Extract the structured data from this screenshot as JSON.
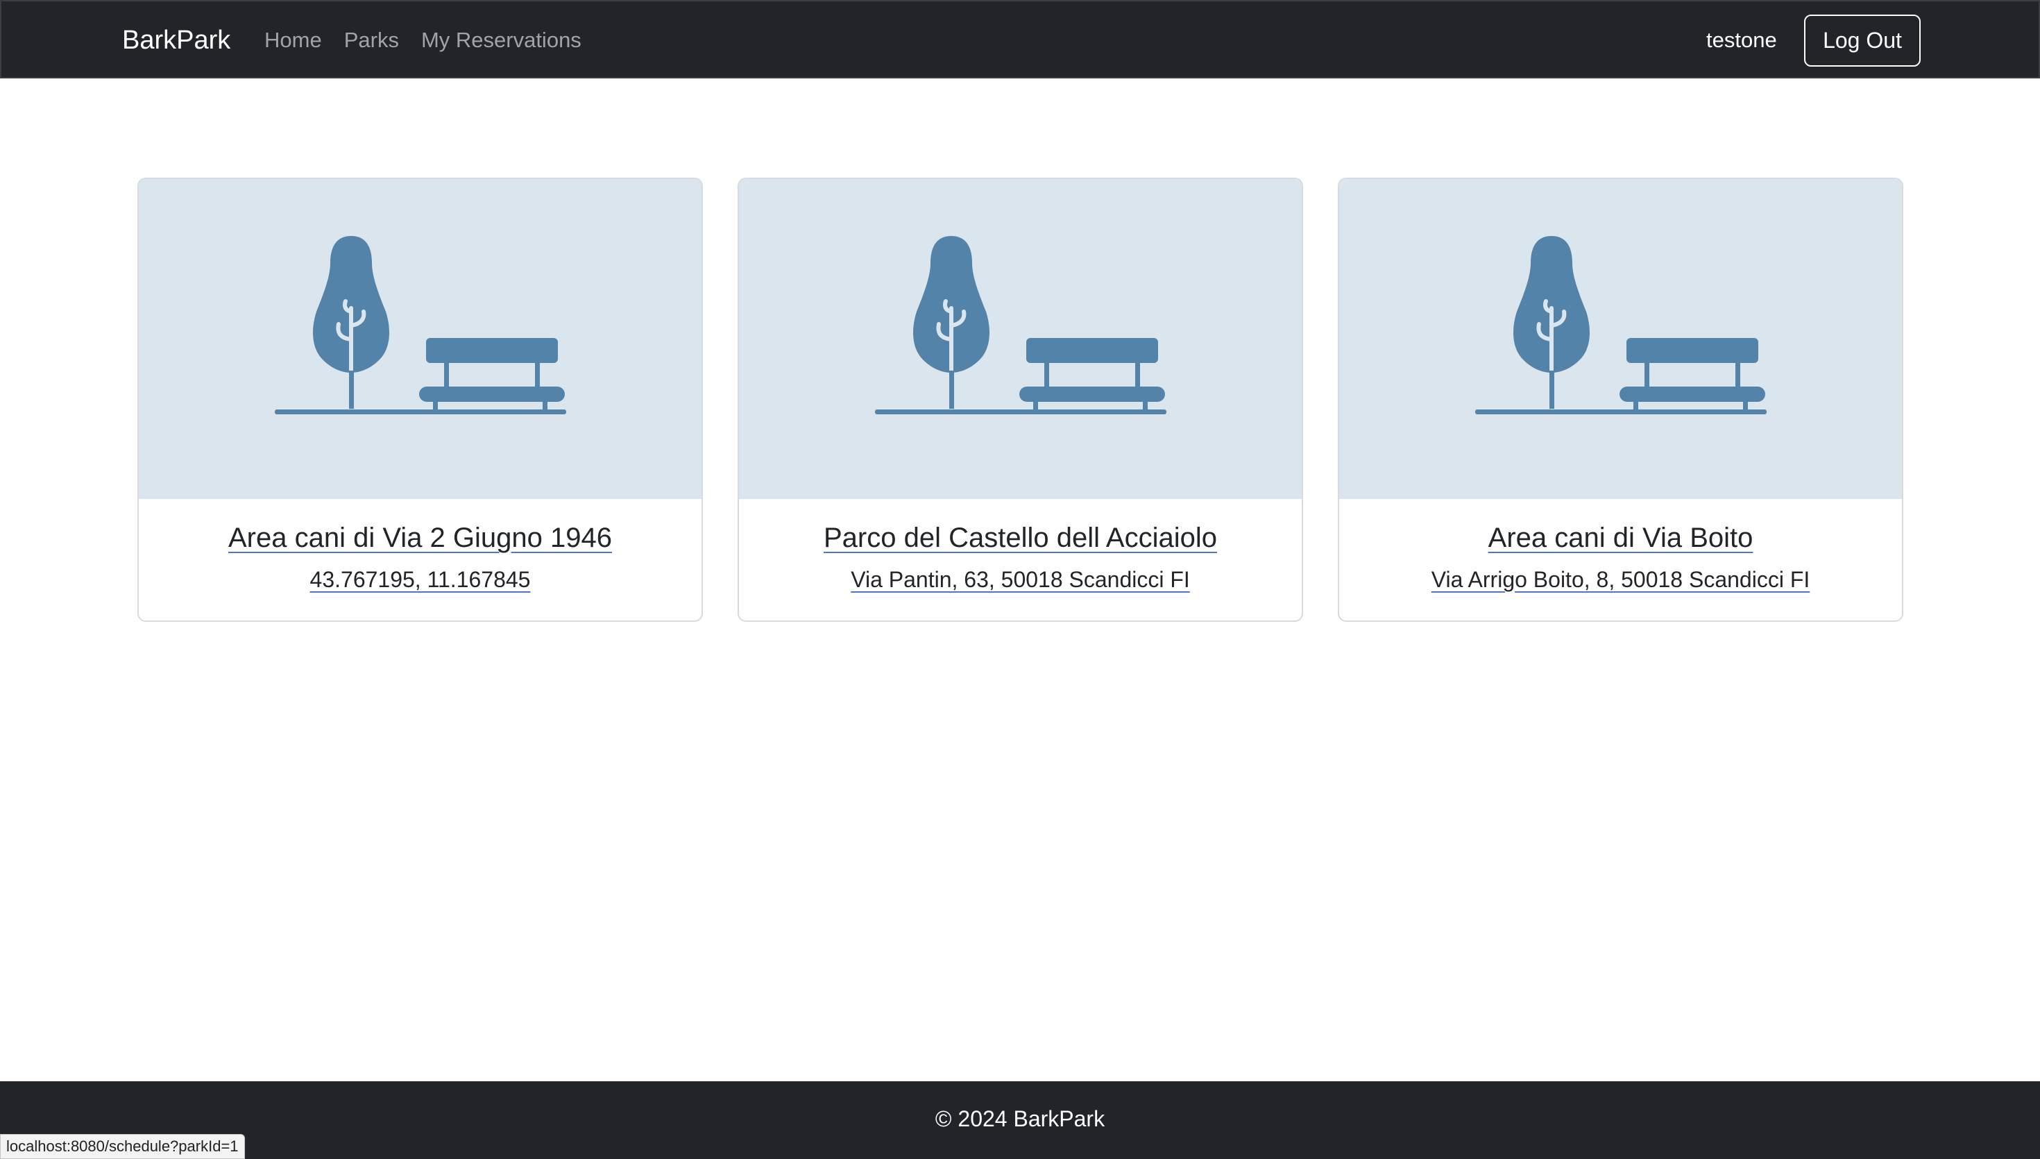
{
  "navbar": {
    "brand": "BarkPark",
    "links": [
      "Home",
      "Parks",
      "My Reservations"
    ],
    "username": "testone",
    "logout_label": "Log Out"
  },
  "parks": [
    {
      "name": "Area cani di Via 2 Giugno 1946",
      "address": "43.767195, 11.167845"
    },
    {
      "name": "Parco del Castello dell Acciaiolo",
      "address": "Via Pantin, 63, 50018 Scandicci FI"
    },
    {
      "name": "Area cani di Via Boito",
      "address": "Via Arrigo Boito, 8, 50018 Scandicci FI"
    }
  ],
  "park_image_icon": "tree-bench-icon",
  "footer": {
    "text": "© 2024 BarkPark"
  },
  "status_bar": {
    "url": "localhost:8080/schedule?parkId=1"
  },
  "colors": {
    "navbar_bg": "#212529",
    "card_image_bg": "#dae5ed",
    "icon_color": "#5383a8",
    "link_underline": "#4a77c9"
  }
}
